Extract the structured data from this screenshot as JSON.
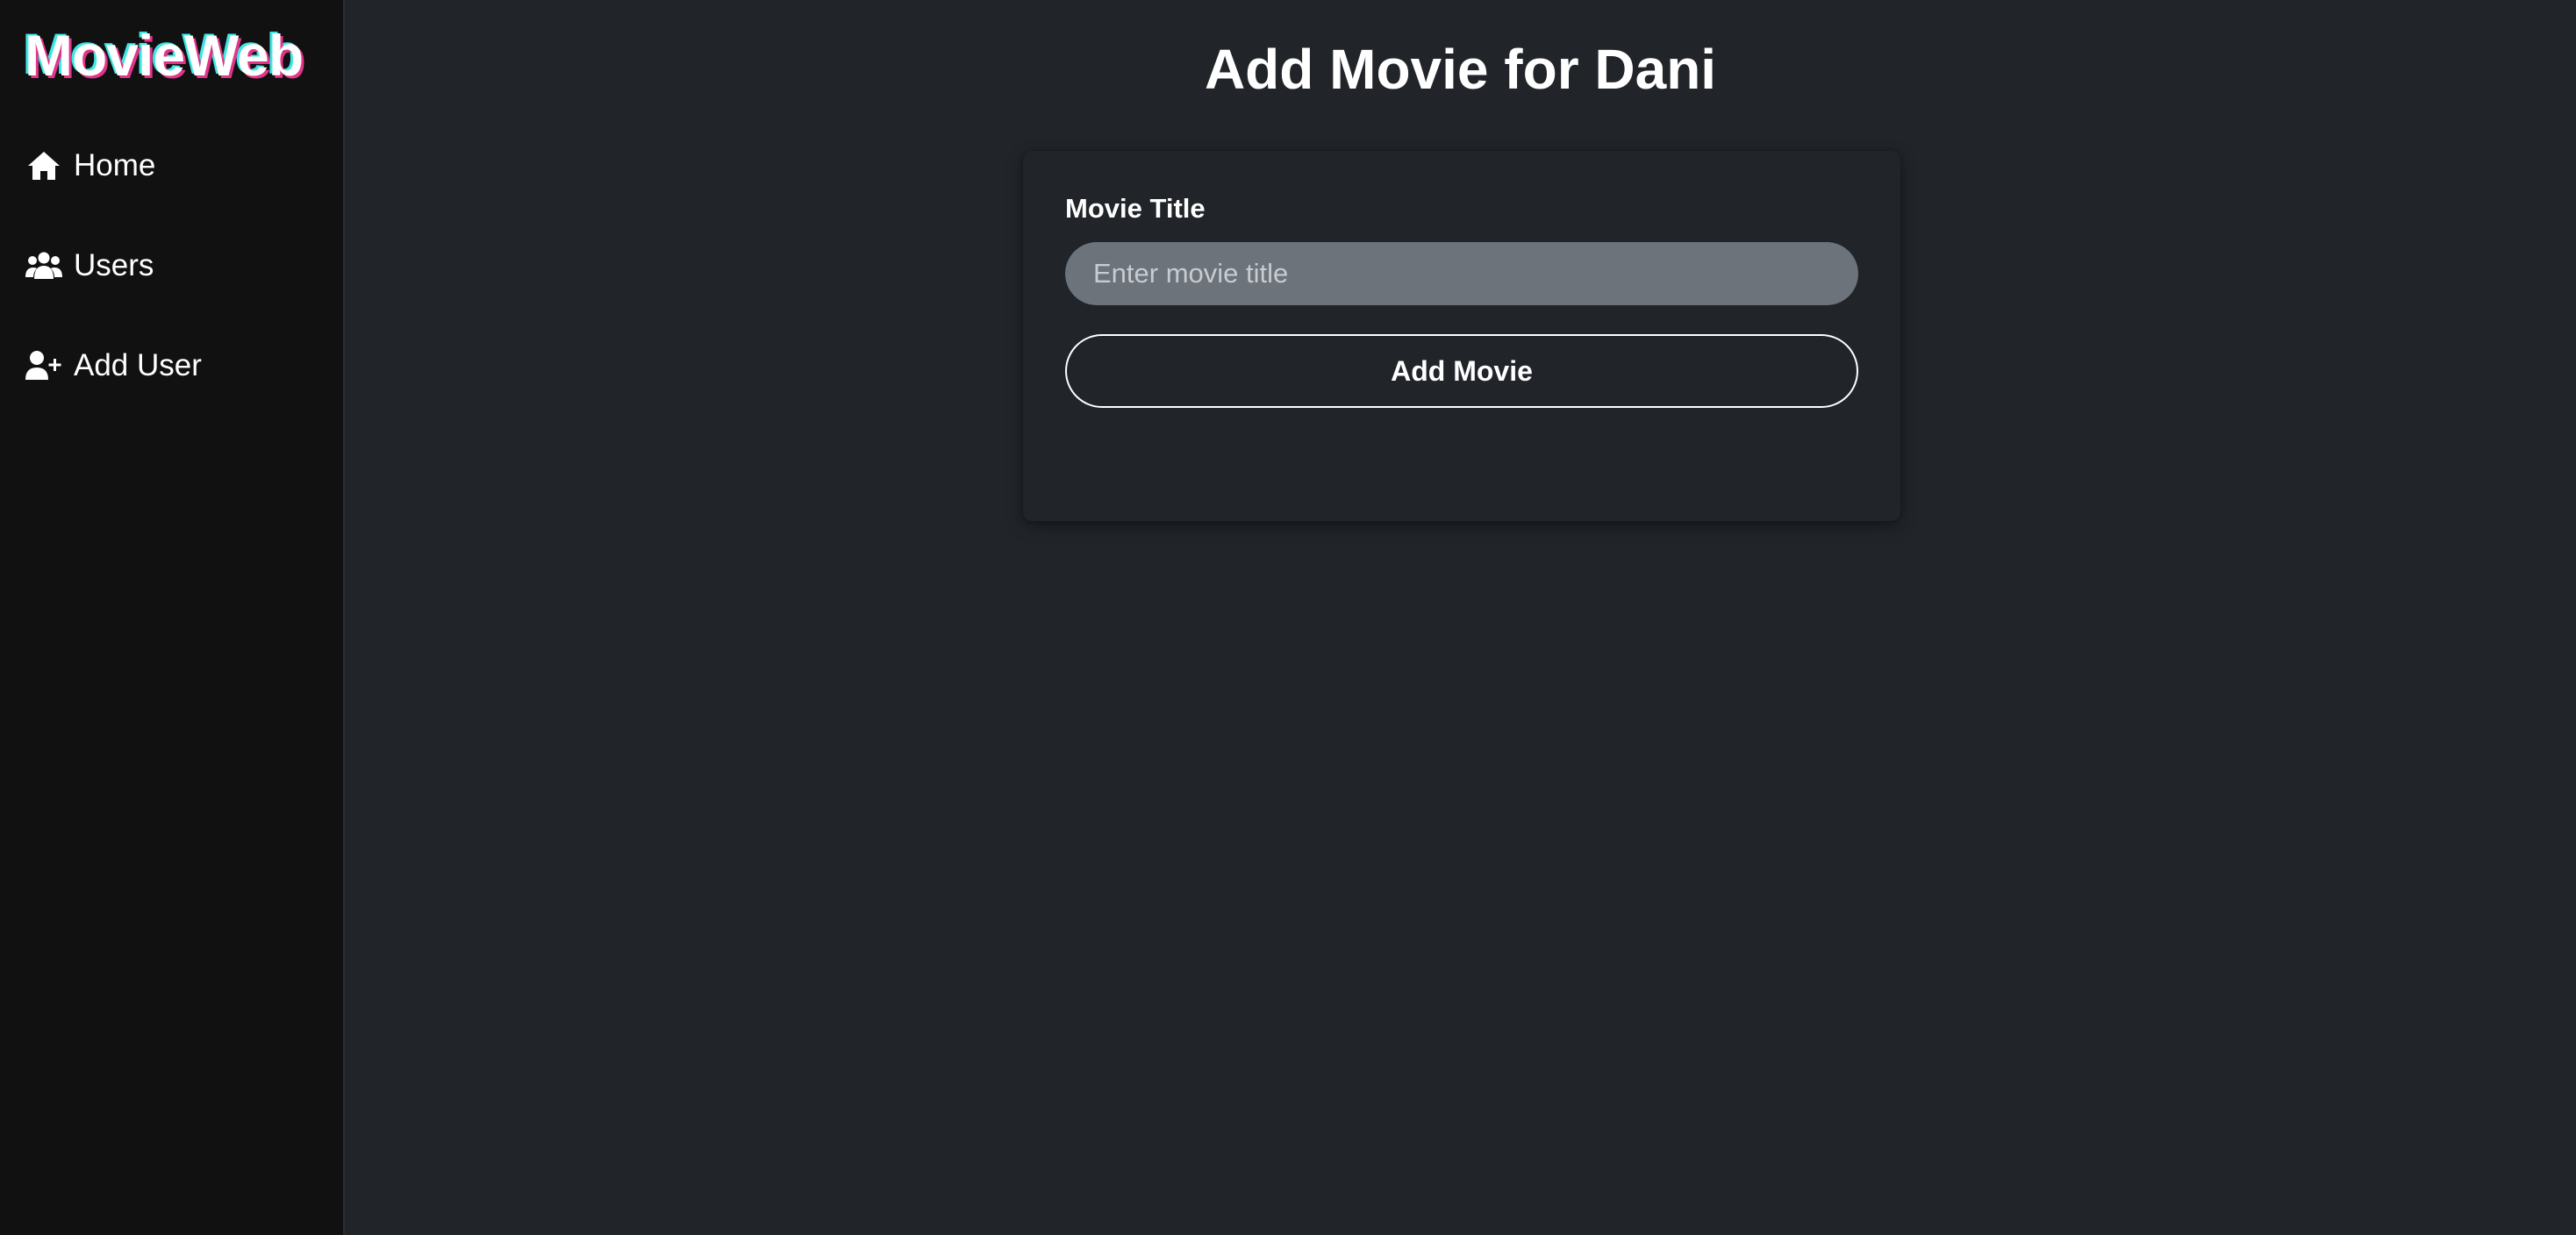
{
  "app": {
    "brand": "MovieWeb"
  },
  "sidebar": {
    "items": [
      {
        "label": "Home",
        "icon": "home-icon"
      },
      {
        "label": "Users",
        "icon": "users-icon"
      },
      {
        "label": "Add User",
        "icon": "user-plus-icon"
      }
    ]
  },
  "main": {
    "title": "Add Movie for Dani",
    "form": {
      "title_label": "Movie Title",
      "title_placeholder": "Enter movie title",
      "title_value": "",
      "submit_label": "Add Movie"
    }
  },
  "colors": {
    "sidebar_bg": "#111111",
    "main_bg": "#212429",
    "input_bg": "#6c737b",
    "brand_shadow_pink": "#e0358a",
    "brand_shadow_cyan": "#3ee6e6"
  }
}
